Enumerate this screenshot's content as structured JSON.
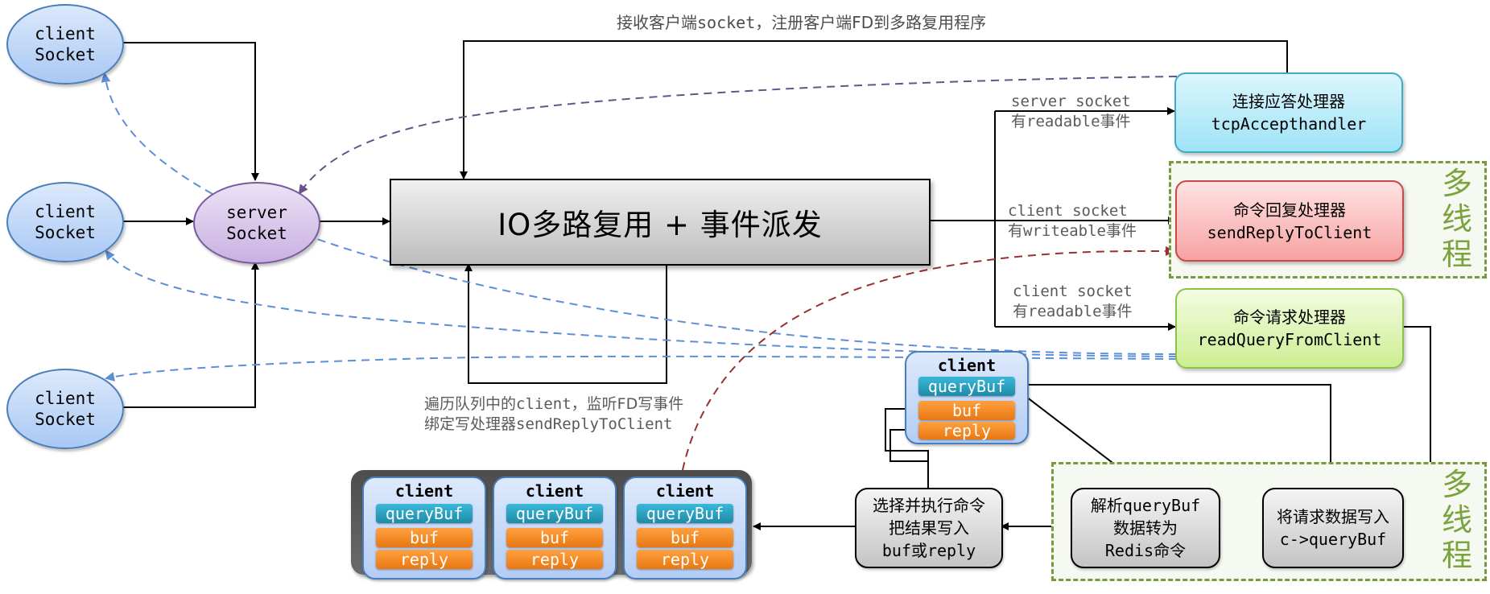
{
  "top_annotation": {
    "cn": "接收客户端",
    "code": "socket",
    "cn2": "，注册客户端FD到多路复用程序"
  },
  "client_sockets": [
    {
      "line1": "client",
      "line2": "Socket"
    },
    {
      "line1": "client",
      "line2": "Socket"
    },
    {
      "line1": "client",
      "line2": "Socket"
    }
  ],
  "server_socket": {
    "line1": "server",
    "line2": "Socket"
  },
  "mux_box": {
    "label": "IO多路复用 + 事件派发"
  },
  "event_labels": [
    {
      "line1": "server socket",
      "line2_cn": "有",
      "line2_code": "readable",
      "line2_cn2": "事件"
    },
    {
      "line1": "client socket",
      "line2_cn": "有",
      "line2_code": "writeable",
      "line2_cn2": "事件"
    },
    {
      "line1": "client socket",
      "line2_cn": "有",
      "line2_code": "readable",
      "line2_cn2": "事件"
    }
  ],
  "handlers": {
    "accept": {
      "title": "连接应答处理器",
      "func": "tcpAccepthandler"
    },
    "reply": {
      "title": "命令回复处理器",
      "func": "sendReplyToClient"
    },
    "read": {
      "title": "命令请求处理器",
      "func": "readQueryFromClient"
    }
  },
  "multi_thread_label": [
    "多",
    "线",
    "程"
  ],
  "client_struct": {
    "title": "client",
    "fields": [
      "queryBuf",
      "buf",
      "reply"
    ]
  },
  "queue_clients": [
    {
      "title": "client",
      "fields": [
        "queryBuf",
        "buf",
        "reply"
      ]
    },
    {
      "title": "client",
      "fields": [
        "queryBuf",
        "buf",
        "reply"
      ]
    },
    {
      "title": "client",
      "fields": [
        "queryBuf",
        "buf",
        "reply"
      ]
    }
  ],
  "queue_note": {
    "line1_cn": "遍历队列中的",
    "line1_code": "client",
    "line1_cn2": "，监听FD写事件",
    "line2_cn": "绑定写处理器",
    "line2_code": "sendReplyToClient"
  },
  "steps": {
    "execute": {
      "line1": "选择并执行命令",
      "line2": "把结果写入",
      "line3": "buf或reply"
    },
    "parse": {
      "line1": "解析queryBuf",
      "line2": "数据转为",
      "line3": "Redis命令"
    },
    "write_query": {
      "line1": "将请求数据写入",
      "line2": "c->queryBuf"
    }
  },
  "colors": {
    "client_blue": "#4a7ebb",
    "server_purple": "#7a5a9e",
    "dashed_blue": "#5b8fd6",
    "dashed_purple": "#6a5288",
    "dashed_red": "#9b3030",
    "multi_thread_green": "#779a3c"
  }
}
